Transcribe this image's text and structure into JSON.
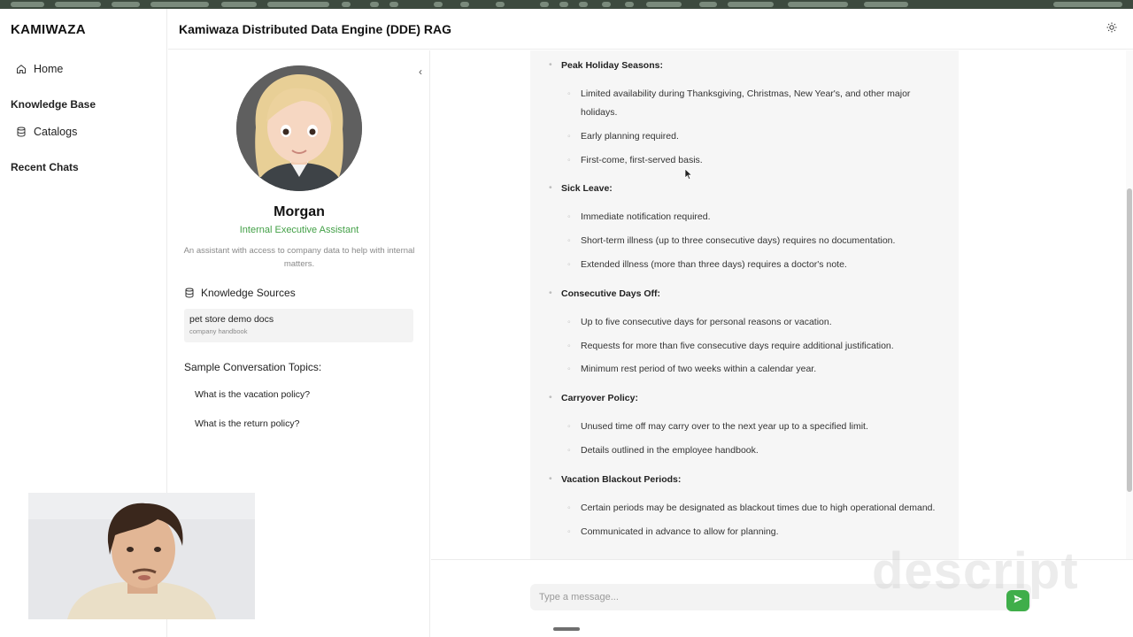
{
  "colors": {
    "accent_green": "#43a047",
    "send_green": "#3fae4a",
    "bubble_bg": "#f6f6f6",
    "card_bg": "#f3f3f3"
  },
  "sidebar": {
    "brand": "KAMIWAZA",
    "home": {
      "label": "Home",
      "icon": "home-icon"
    },
    "knowledge_base_title": "Knowledge Base",
    "catalogs": {
      "label": "Catalogs",
      "icon": "database-icon"
    },
    "recent_chats_title": "Recent Chats"
  },
  "header": {
    "title": "Kamiwaza Distributed Data Engine (DDE) RAG",
    "theme_icon": "sun-icon"
  },
  "assistant": {
    "name": "Morgan",
    "role": "Internal Executive Assistant",
    "description": "An assistant with access to company data to help with internal matters.",
    "knowledge_sources_title": "Knowledge Sources",
    "knowledge_sources": [
      {
        "title": "pet store demo docs",
        "subtitle": "company handbook"
      }
    ],
    "topics_title": "Sample Conversation Topics:",
    "topics": [
      "What is the vacation policy?",
      "What is the return policy?"
    ]
  },
  "message": {
    "sections": [
      {
        "heading": "Peak Holiday Seasons:",
        "items": [
          "Limited availability during Thanksgiving, Christmas, New Year's, and other major holidays.",
          "Early planning required.",
          "First-come, first-served basis."
        ]
      },
      {
        "heading": "Sick Leave:",
        "items": [
          "Immediate notification required.",
          "Short-term illness (up to three consecutive days) requires no documentation.",
          "Extended illness (more than three days) requires a doctor's note."
        ]
      },
      {
        "heading": "Consecutive Days Off:",
        "items": [
          "Up to five consecutive days for personal reasons or vacation.",
          "Requests for more than five consecutive days require additional justification.",
          "Minimum rest period of two weeks within a calendar year."
        ]
      },
      {
        "heading": "Carryover Policy:",
        "items": [
          "Unused time off may carry over to the next year up to a specified limit.",
          "Details outlined in the employee handbook."
        ]
      },
      {
        "heading": "Vacation Blackout Periods:",
        "items": [
          "Certain periods may be designated as blackout times due to high operational demand.",
          "Communicated in advance to allow for planning."
        ]
      }
    ]
  },
  "composer": {
    "placeholder": "Type a message...",
    "value": "",
    "send_icon": "send-icon"
  },
  "watermark": "descript"
}
